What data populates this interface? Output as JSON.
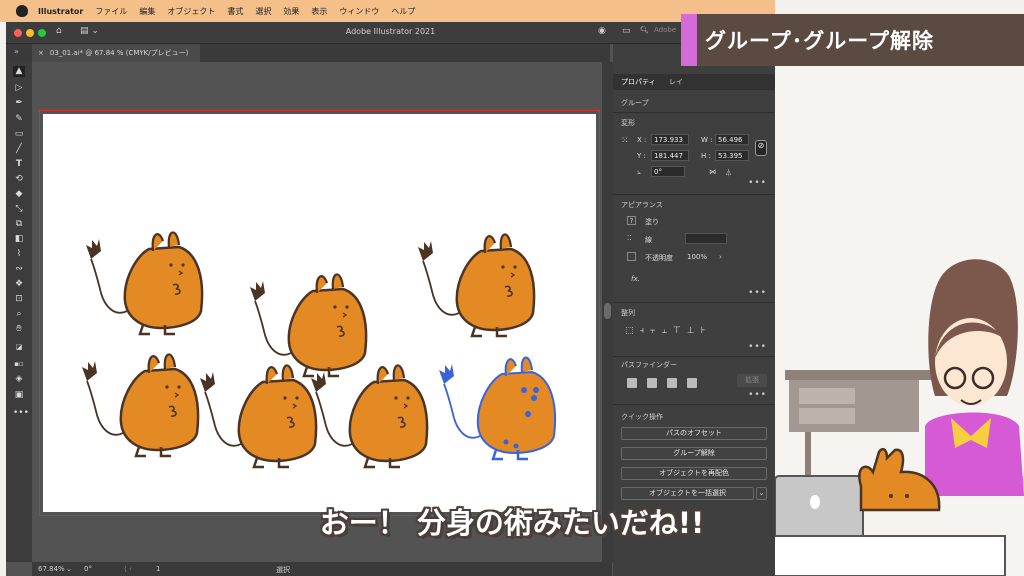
{
  "menubar": {
    "app": "Illustrator",
    "items": [
      "ファイル",
      "編集",
      "オブジェクト",
      "書式",
      "選択",
      "効果",
      "表示",
      "ウィンドウ",
      "ヘルプ"
    ]
  },
  "window": {
    "title": "Adobe Illustrator 2021",
    "document_tab": "03_01.ai* @ 67.84 % (CMYK/プレビュー)",
    "search_placeholder": "Adobe"
  },
  "statusbar": {
    "zoom": "67.84%",
    "rotation": "0°",
    "artboard_number": "1",
    "mode": "選択"
  },
  "panel": {
    "tabs": [
      "プロパティ",
      "レイ"
    ],
    "selection_type": "グループ",
    "transform": {
      "heading": "変形",
      "x_label": "X :",
      "x_value": "173.933",
      "y_label": "Y :",
      "y_value": "181.447",
      "w_label": "W :",
      "w_value": "56.496",
      "h_label": "H :",
      "h_value": "53.395",
      "angle": "0°"
    },
    "appearance": {
      "heading": "アピアランス",
      "fill_label": "塗り",
      "stroke_label": "線",
      "opacity_label": "不透明度",
      "opacity_value": "100%",
      "fx_label": "fx."
    },
    "align": {
      "heading": "整列"
    },
    "pathfinder": {
      "heading": "パスファインダー",
      "expand_label": "拡張"
    },
    "quick_actions": {
      "heading": "クイック操作",
      "buttons": [
        "パスのオフセット",
        "グループ解除",
        "オブジェクトを再配色",
        "オブジェクトを一括選択"
      ]
    }
  },
  "banner": {
    "title": "グループ･グループ解除"
  },
  "caption": "おー！ 分身の術みたいだね!!",
  "colors": {
    "menubar": "#f5bf8a",
    "banner_bg": "#5b4a42",
    "banner_accent": "#d56ad9",
    "creature_orange": "#e38a24",
    "creature_outline": "#4a3426",
    "selection_blue": "#3b63d9",
    "artboard_border": "#cc3333"
  },
  "icons": [
    "apple-icon",
    "home-icon",
    "workspace-icon",
    "search-icon",
    "link-icon",
    "fx-icon",
    "more-icon"
  ]
}
